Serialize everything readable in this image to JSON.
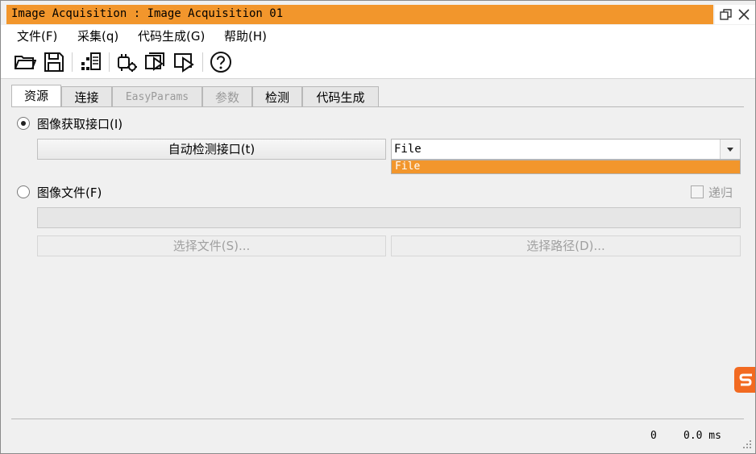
{
  "window": {
    "title": "Image Acquisition : Image Acquisition 01",
    "accent_color": "#f2962c",
    "controls": [
      "restore-icon",
      "close-icon"
    ]
  },
  "menu": {
    "items": [
      {
        "label": "文件(F)"
      },
      {
        "label": "采集(q)"
      },
      {
        "label": "代码生成(G)"
      },
      {
        "label": "帮助(H)"
      }
    ]
  },
  "toolbar": {
    "icons": [
      "open-folder-icon",
      "save-icon",
      "code-gen-icon",
      "settings-icon",
      "acquire-continuous-icon",
      "acquire-single-icon",
      "help-icon"
    ]
  },
  "tabs": [
    {
      "label": "资源",
      "active": true,
      "disabled": false
    },
    {
      "label": "连接",
      "active": false,
      "disabled": false
    },
    {
      "label": "EasyParams",
      "active": false,
      "disabled": true
    },
    {
      "label": "参数",
      "active": false,
      "disabled": true
    },
    {
      "label": "检测",
      "active": false,
      "disabled": false
    },
    {
      "label": "代码生成",
      "active": false,
      "disabled": false
    }
  ],
  "source": {
    "interface_radio": {
      "label": "图像获取接口(I)",
      "selected": true
    },
    "autodetect_button": "自动检测接口(t)",
    "interface_combo": {
      "value": "File",
      "options": [
        "File"
      ],
      "highlighted": "File"
    },
    "file_radio": {
      "label": "图像文件(F)",
      "selected": false
    },
    "recursive_checkbox": {
      "label": "递归",
      "checked": false
    },
    "path_value": "",
    "select_file_button": "选择文件(S)...",
    "select_path_button": "选择路径(D)..."
  },
  "statusbar": {
    "frame_count": "0",
    "time": "0.0 ms"
  }
}
